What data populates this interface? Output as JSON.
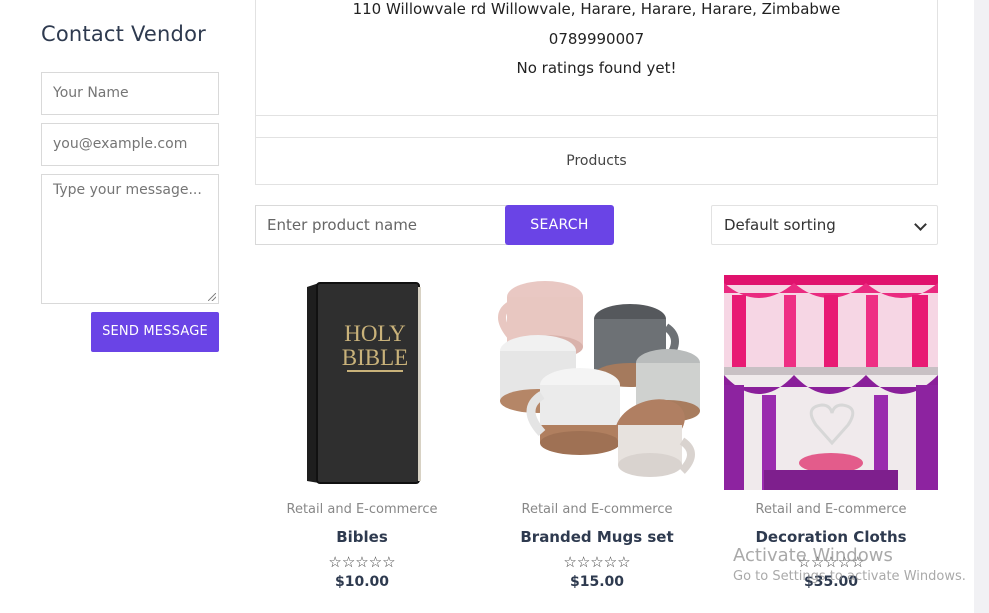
{
  "sidebar": {
    "title": "Contact Vendor",
    "name_placeholder": "Your Name",
    "email_placeholder": "you@example.com",
    "message_placeholder": "Type your message...",
    "send_label": "SEND MESSAGE"
  },
  "vendor": {
    "address": "110 Willowvale rd Willowvale, Harare, Harare, Harare, Zimbabwe",
    "phone": "0789990007",
    "rating_text": "No ratings found yet!"
  },
  "tabs": {
    "products": "Products"
  },
  "search": {
    "placeholder": "Enter product name",
    "button_label": "SEARCH",
    "sort_selected": "Default sorting"
  },
  "products": [
    {
      "category": "Retail and E-commerce",
      "name": "Bibles",
      "price": "$10.00",
      "stars": "☆☆☆☆☆"
    },
    {
      "category": "Retail and E-commerce",
      "name": "Branded Mugs set",
      "price": "$15.00",
      "stars": "☆☆☆☆☆"
    },
    {
      "category": "Retail and E-commerce",
      "name": "Decoration Cloths",
      "price": "$35.00",
      "stars": "☆☆☆☆☆"
    }
  ],
  "watermark": {
    "line1": "Activate Windows",
    "line2": "Go to Settings to activate Windows."
  },
  "colors": {
    "accent": "#6a44e6",
    "heading": "#2e3a4f"
  }
}
